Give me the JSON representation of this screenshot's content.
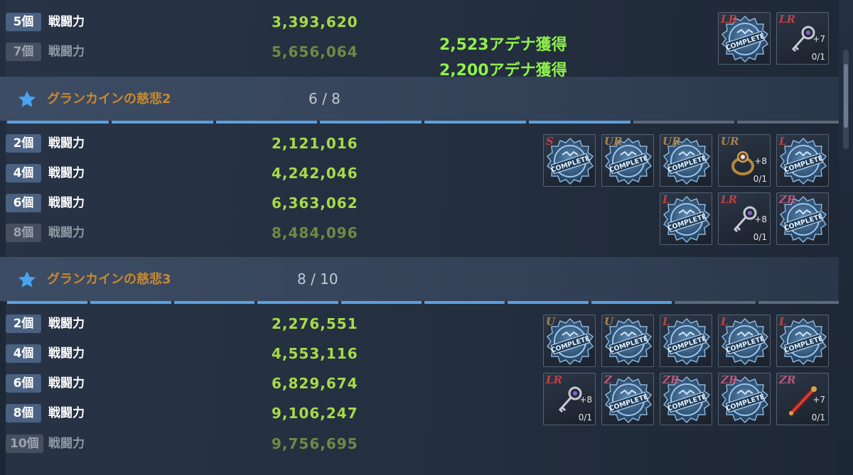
{
  "colors": {
    "accent_blue": "#5aa0df",
    "value_green": "#a7db48",
    "title_orange": "#c8892e",
    "reward_green": "#8ff04a"
  },
  "stat_label": "戦闘力",
  "top_rows": [
    {
      "count": "5個",
      "value": "3,393,620",
      "achieved": true
    },
    {
      "count": "7個",
      "value": "5,656,064",
      "achieved": false
    }
  ],
  "rewards": [
    "2,523アデナ獲得",
    "2,200アデナ獲得"
  ],
  "sections": [
    {
      "title": "グランカインの慈悲2",
      "progress": "6 / 8",
      "progress_value": 6,
      "progress_max": 8,
      "rows": [
        {
          "count": "2個",
          "value": "2,121,016",
          "achieved": true
        },
        {
          "count": "4個",
          "value": "4,242,046",
          "achieved": true
        },
        {
          "count": "6個",
          "value": "6,363,062",
          "achieved": true
        },
        {
          "count": "8個",
          "value": "8,484,096",
          "achieved": false
        }
      ]
    },
    {
      "title": "グランカインの慈悲3",
      "progress": "8 / 10",
      "progress_value": 8,
      "progress_max": 10,
      "rows": [
        {
          "count": "2個",
          "value": "2,276,551",
          "achieved": true
        },
        {
          "count": "4個",
          "value": "4,553,116",
          "achieved": true
        },
        {
          "count": "6個",
          "value": "6,829,674",
          "achieved": true
        },
        {
          "count": "8個",
          "value": "9,106,247",
          "achieved": true
        },
        {
          "count": "10個",
          "value": "9,756,695",
          "achieved": false
        }
      ]
    }
  ],
  "stamp_text": "COMPLETE",
  "tiles": {
    "top": [
      {
        "rarity": "LR",
        "complete": true
      },
      {
        "rarity": "LR",
        "complete": false,
        "item": "key-icon",
        "plus": "+7",
        "count": "0/1"
      }
    ],
    "s2_row1": [
      {
        "rarity": "S",
        "complete": true
      },
      {
        "rarity": "UR",
        "complete": true
      },
      {
        "rarity": "UR",
        "complete": true
      },
      {
        "rarity": "UR",
        "complete": false,
        "item": "ring-icon",
        "plus": "+8",
        "count": "0/1"
      },
      {
        "rarity": "L",
        "complete": true
      }
    ],
    "s2_row2": [
      {
        "rarity": "L",
        "complete": true
      },
      {
        "rarity": "LR",
        "complete": false,
        "item": "key-icon",
        "plus": "+8",
        "count": "0/1"
      },
      {
        "rarity": "ZR",
        "complete": true
      }
    ],
    "s3_row1": [
      {
        "rarity": "U",
        "complete": true
      },
      {
        "rarity": "U",
        "complete": true
      },
      {
        "rarity": "L",
        "complete": true
      },
      {
        "rarity": "L",
        "complete": true
      },
      {
        "rarity": "L",
        "complete": true
      }
    ],
    "s3_row2": [
      {
        "rarity": "LR",
        "complete": false,
        "item": "key-icon",
        "plus": "+8",
        "count": "0/1"
      },
      {
        "rarity": "Z",
        "complete": true
      },
      {
        "rarity": "ZR",
        "complete": true
      },
      {
        "rarity": "ZR",
        "complete": true
      },
      {
        "rarity": "ZR",
        "complete": false,
        "item": "staff-icon",
        "plus": "+7",
        "count": "0/1"
      }
    ]
  }
}
